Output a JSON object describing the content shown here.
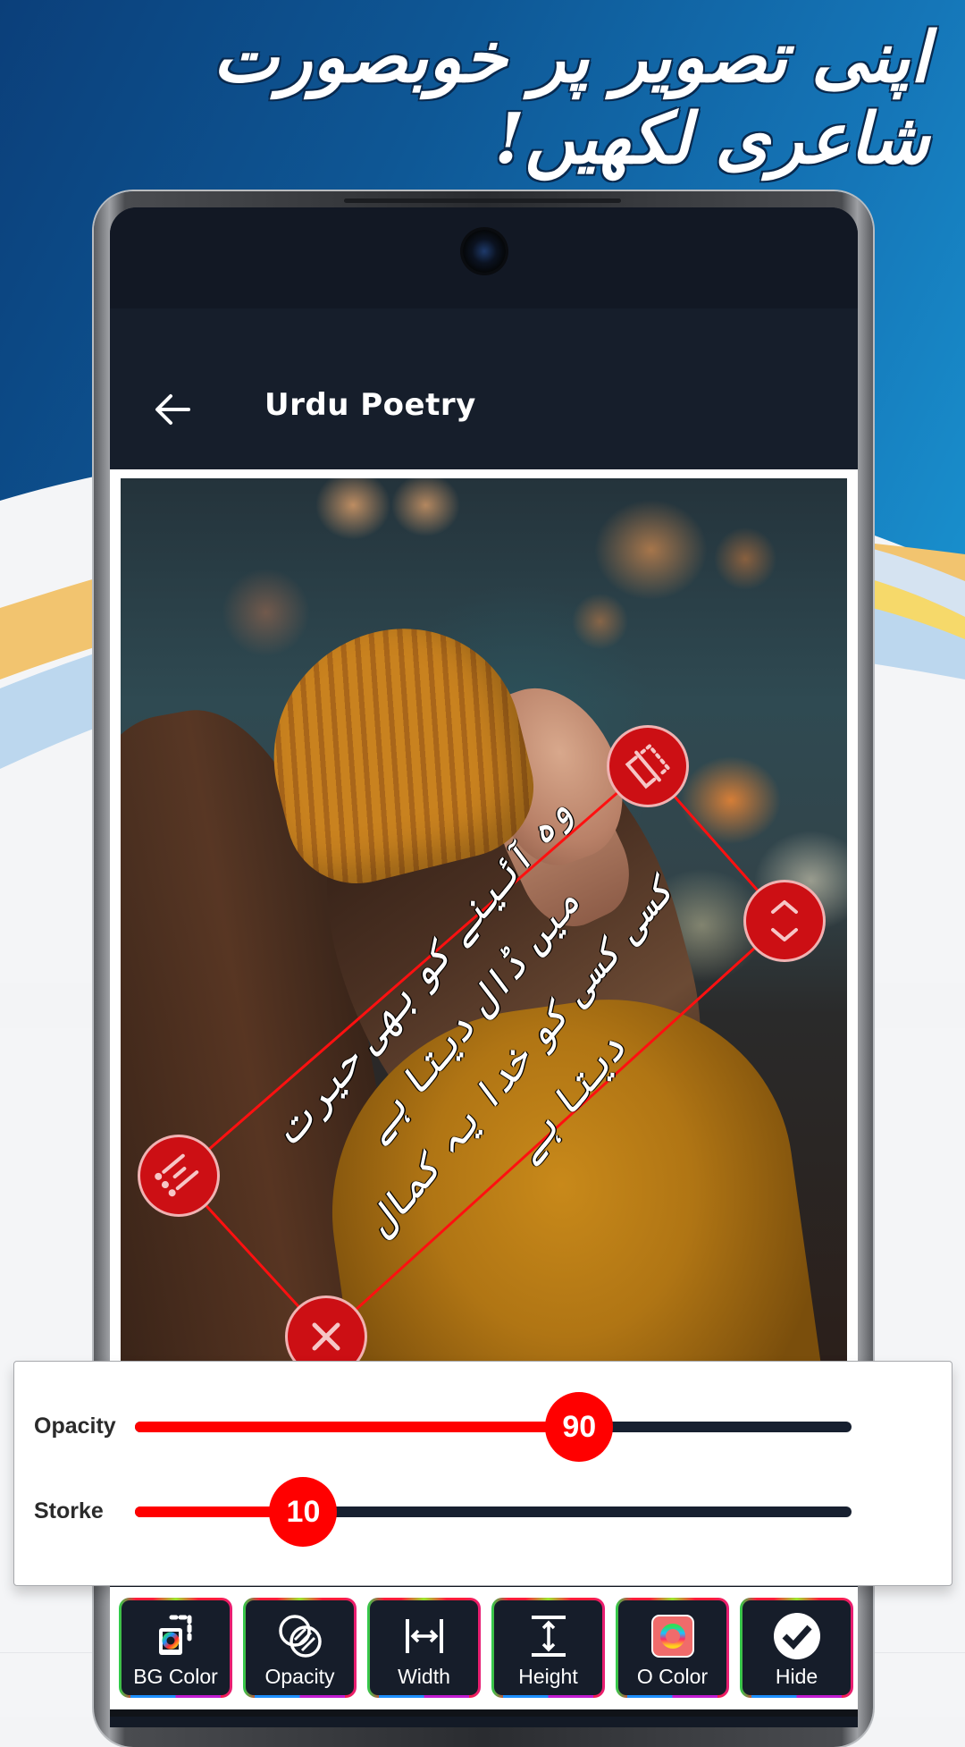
{
  "promo": {
    "headline": "اپنی تصویر پر خوبصورت شاعری لکھیں!"
  },
  "app_bar": {
    "back_icon": "arrow-left-icon",
    "title": "Urdu Poetry"
  },
  "editor": {
    "poetry_lines": [
      "وہ آئینے کو بھی حیرت میں ڈال دیتا ہے",
      "کسی کسی کو خدا یہ کمال دیتا ہے"
    ],
    "handles": {
      "top": "flip-icon",
      "right": "resize-vertical-icon",
      "left": "text-style-icon",
      "bottom": "close-icon"
    },
    "accent_color": "#cc0f14"
  },
  "sliders": [
    {
      "label": "Opacity",
      "value": 90,
      "min": 0,
      "max": 150,
      "fill_fraction": 0.62
    },
    {
      "label": "Storke",
      "value": 10,
      "min": 0,
      "max": 150,
      "fill_fraction": 0.235
    }
  ],
  "slider_colors": {
    "active": "#ff0000",
    "inactive": "#172030"
  },
  "toolbar": [
    {
      "label": "BG Color",
      "icon": "bg-color-icon"
    },
    {
      "label": "Opacity",
      "icon": "opacity-icon"
    },
    {
      "label": "Width",
      "icon": "width-icon"
    },
    {
      "label": "Height",
      "icon": "height-icon"
    },
    {
      "label": "O Color",
      "icon": "outline-color-icon"
    },
    {
      "label": "Hide",
      "icon": "check-circle-icon"
    }
  ]
}
